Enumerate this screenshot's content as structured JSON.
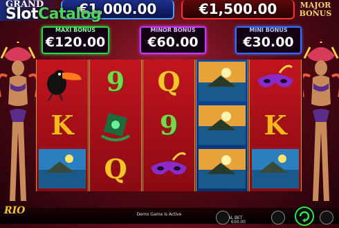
{
  "branding": {
    "site_logo_prefix": "Slot",
    "site_logo_suffix": "Catalog",
    "game_logo": "RIO"
  },
  "jackpots": {
    "grand_label": "GRAND",
    "grand_value": "€1,000.00",
    "major_label": "MAJOR BONUS",
    "major_value": "€1,500.00"
  },
  "bonuses": [
    {
      "label": "MAXI BONUS",
      "value": "€120.00"
    },
    {
      "label": "MINOR BONUS",
      "value": "€60.00"
    },
    {
      "label": "MINI BONUS",
      "value": "€30.00"
    }
  ],
  "reels": [
    {
      "color": "red",
      "symbols": [
        "toucan",
        "K",
        "pyramid"
      ]
    },
    {
      "color": "red",
      "symbols": [
        "9",
        "gem-idol",
        "Q"
      ]
    },
    {
      "color": "red",
      "symbols": [
        "Q",
        "9",
        "mask"
      ]
    },
    {
      "color": "blue",
      "symbols": [
        "pyramid",
        "pyramid",
        "pyramid"
      ]
    },
    {
      "color": "red",
      "symbols": [
        "mask",
        "K",
        "pyramid"
      ]
    }
  ],
  "footer": {
    "demo_text": "Demo Game Is Active",
    "total_bet_label": "TOTAL BET",
    "total_bet_value": "€00.00"
  },
  "colors": {
    "maxi": "#2fd64a",
    "minor": "#c53cff",
    "mini": "#3a6bff",
    "spin": "#2ee84a"
  }
}
